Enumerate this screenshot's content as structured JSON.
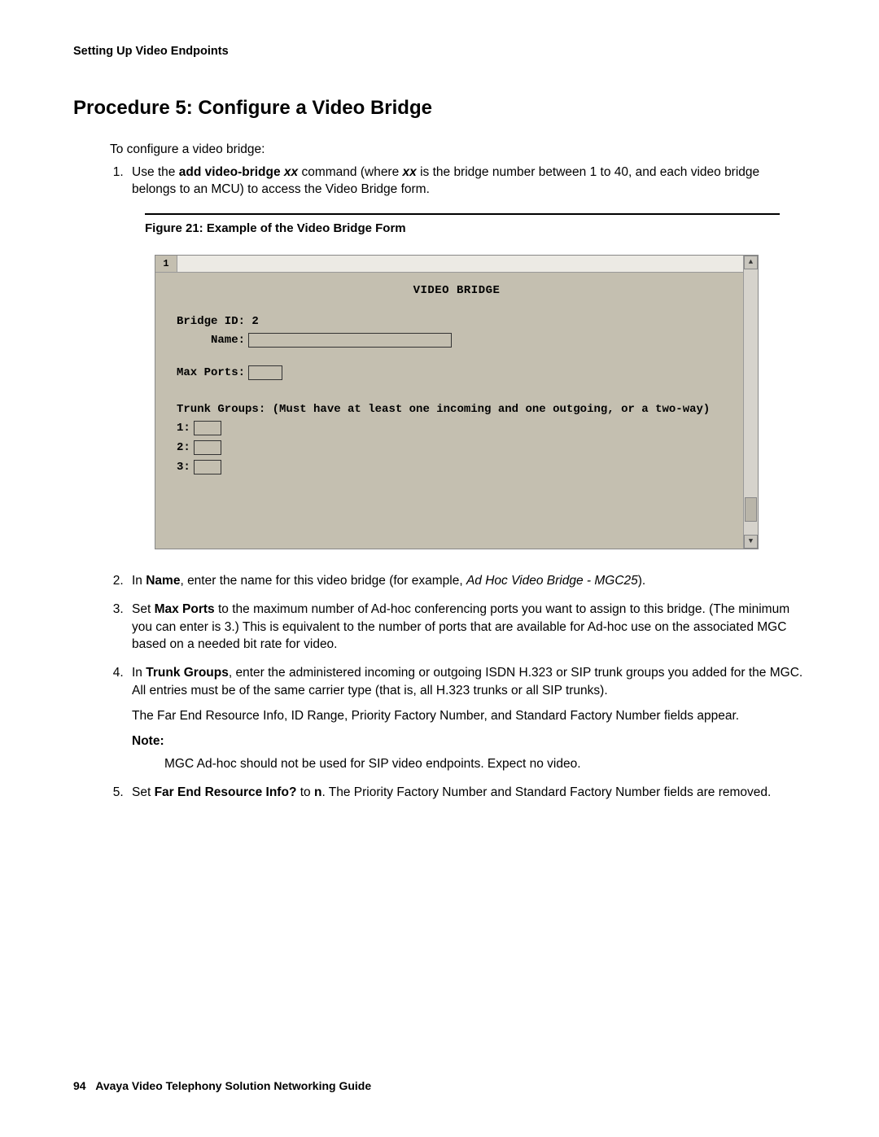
{
  "header": "Setting Up Video Endpoints",
  "title": "Procedure 5: Configure a Video Bridge",
  "intro": "To configure a video bridge:",
  "steps": {
    "s1": {
      "pre": "Use the ",
      "cmd": "add video-bridge ",
      "arg1": "xx",
      "mid": " command (where ",
      "arg2": "xx",
      "post": " is the bridge number between 1 to 40, and each video bridge belongs to an MCU) to access the Video Bridge form."
    },
    "s2": {
      "pre": "In ",
      "b": "Name",
      "mid1": ", enter the name for this video bridge (for example, ",
      "ex": "Ad Hoc Video Bridge - MGC25",
      "mid2": ")."
    },
    "s3": {
      "pre": "Set ",
      "b": "Max Ports",
      "post": " to the maximum number of Ad-hoc conferencing ports you want to assign to this bridge. (The minimum you can enter is 3.) This is equivalent to the number of ports that are available for Ad-hoc use on the associated MGC based on a needed bit rate for video."
    },
    "s4": {
      "pre": "In ",
      "b": "Trunk Groups",
      "p1": ", enter the administered incoming or outgoing ISDN H.323 or SIP trunk groups you added for the MGC. All entries must be of the same carrier type (that is, all H.323 trunks or all SIP trunks).",
      "p2": "The Far End Resource Info, ID Range, Priority Factory Number, and Standard Factory Number fields appear.",
      "note_label": "Note:",
      "note_body": "MGC Ad-hoc should not be used for SIP video endpoints. Expect no video."
    },
    "s5": {
      "pre": "Set ",
      "b": "Far End Resource Info?",
      "mid": " to ",
      "val": "n",
      "post": ". The Priority Factory Number and Standard Factory Number fields are removed."
    }
  },
  "figure_caption": "Figure 21: Example of the Video Bridge Form",
  "terminal": {
    "tab": "1",
    "title": "VIDEO BRIDGE",
    "bridge_id_label": "Bridge ID: ",
    "bridge_id_value": "2",
    "name_label": "     Name:",
    "max_ports_label": "Max Ports:",
    "trunk_groups_label": "Trunk Groups: (Must have at least one incoming and one outgoing, or a two-way)",
    "tg1": "1:",
    "tg2": "2:",
    "tg3": "3:"
  },
  "footer": {
    "page": "94",
    "title": "Avaya Video Telephony Solution Networking Guide"
  }
}
